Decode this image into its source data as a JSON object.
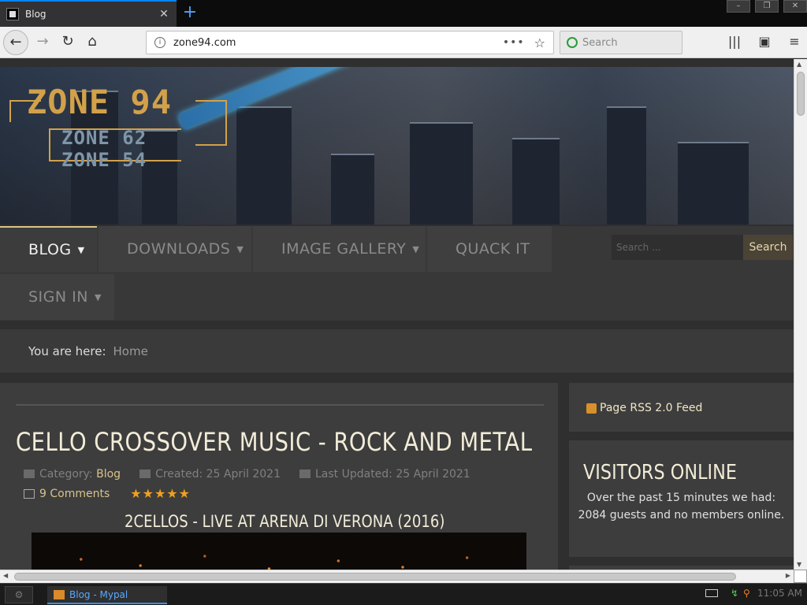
{
  "browser": {
    "tab_title": "Blog",
    "tab_close": "✕",
    "new_tab": "+",
    "url": "zone94.com",
    "page_actions": "•••",
    "search_placeholder": "Search"
  },
  "site": {
    "menu": [
      {
        "label": "BLOG",
        "caret": "▼"
      },
      {
        "label": "DOWNLOADS",
        "caret": "▼"
      },
      {
        "label": "IMAGE GALLERY",
        "caret": "▼"
      },
      {
        "label": "QUACK IT"
      },
      {
        "label": "SIGN IN",
        "caret": "▼"
      }
    ],
    "search_placeholder": "Search ...",
    "search_button": "Search",
    "breadcrumb_label": "You are here:",
    "breadcrumb_home": "Home"
  },
  "article": {
    "title": "CELLO CROSSOVER MUSIC - ROCK AND METAL",
    "category_label": "Category:",
    "category": "Blog",
    "created": "Created: 25 April 2021",
    "updated": "Last Updated: 25 April 2021",
    "comments": "9 Comments",
    "rating_stars": 5,
    "stars": "★★★★★",
    "subtitle": "2CELLOS - LIVE AT ARENA DI VERONA (2016)"
  },
  "sidebar": {
    "rss": "Page RSS 2.0 Feed",
    "visitors_title": "VISITORS ONLINE",
    "visitors_text": "Over the past 15 minutes we had: 2084 guests and no members online."
  },
  "taskbar": {
    "task_label": "Blog - Mypal",
    "time": "11:05 AM"
  },
  "colors": {
    "accent": "#d8c38a",
    "star": "#f0a020",
    "browser_blue": "#0a84ff"
  }
}
